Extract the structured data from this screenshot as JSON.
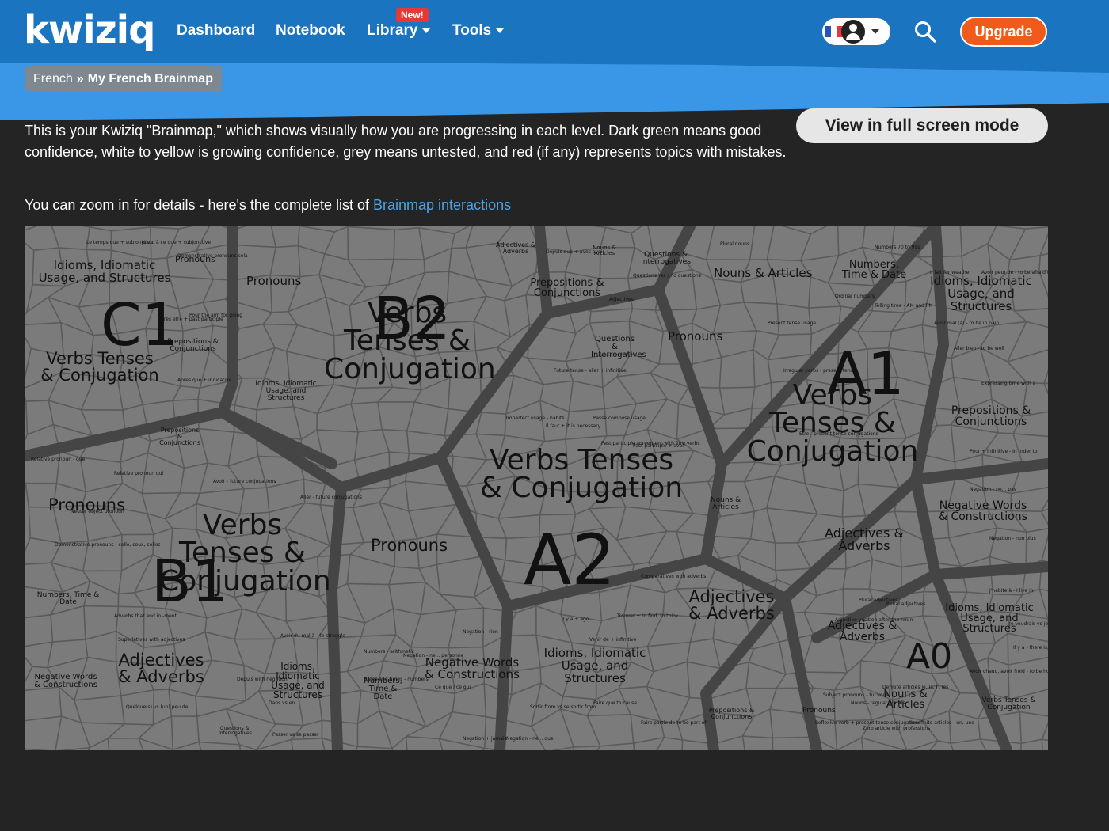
{
  "header": {
    "logo": "kwiziq",
    "nav": [
      {
        "label": "Dashboard"
      },
      {
        "label": "Notebook"
      },
      {
        "label": "Library"
      },
      {
        "label": "Tools"
      }
    ],
    "new_badge": "New!",
    "upgrade": "Upgrade"
  },
  "breadcrumb": {
    "parent": "French",
    "sep": "»",
    "current": "My French Brainmap"
  },
  "fullscreen_label": "View in full screen mode",
  "intro": "This is your Kwiziq \"Brainmap,\" which shows visually how you are progressing in each level. Dark green means good confidence, white to yellow is growing confidence, grey means untested, and red (if any) represents topics with mistakes.",
  "intro2_text": "You can zoom in for details - here's the complete list of ",
  "intro2_link": "Brainmap interactions",
  "brainmap": {
    "levels": {
      "c1": "C1",
      "b2": "B2",
      "a1": "A1",
      "a2": "A2",
      "b1": "B1",
      "a0": "A0"
    },
    "labels": {
      "c1_idioms": "Idioms, Idiomatic Usage, and Structures",
      "c1_pronouns": "Pronouns",
      "c1_verbs": "Verbs Tenses & Conjugation",
      "c1_prep": "Prepositions & Conjunctions",
      "b2_pronouns": "Pronouns",
      "b2_verbs": "Verbs Tenses & Conjugation",
      "b2_prep": "Prepositions & Conjunctions",
      "b2_questions": "Questions & Interrogatives",
      "b2_adj": "Adjectives & Adverbs",
      "b2_nouns": "Nouns & Articles",
      "b2_idioms": "Idioms, Idiomatic Usage, and Structures",
      "a1_nouns": "Nouns & Articles",
      "a1_numbers": "Numbers, Time & Date",
      "a1_idioms": "Idioms, Idiomatic Usage, and Structures",
      "a1_questions": "Questions & Interrogatives",
      "a1_pronouns": "Pronouns",
      "a1_verbs": "Verbs Tenses & Conjugation",
      "a1_prep": "Prepositions & Conjunctions",
      "a1_negative": "Negative Words & Constructions",
      "a1_adj": "Adjectives & Adverbs",
      "b1_pronouns": "Pronouns",
      "b1_verbs": "Verbs Tenses & Conjugation",
      "b1_numbers": "Numbers, Time & Date",
      "b1_adj": "Adjectives & Adverbs",
      "b1_negative": "Negative Words & Constructions",
      "b1_idioms": "Idioms, Idiomatic Usage, and Structures",
      "b1_questions": "Questions & Interrogatives",
      "b1_prep": "Prepositions & Conjunctions",
      "a2_verbs": "Verbs Tenses & Conjugation",
      "a2_pronouns": "Pronouns",
      "a2_nouns": "Nouns & Articles",
      "a2_adj": "Adjectives & Adverbs",
      "a2_numbers": "Numbers, Time & Date",
      "a2_negative": "Negative Words & Constructions",
      "a2_idioms": "Idioms, Idiomatic Usage, and Structures",
      "a2_prep": "Prepositions & Conjunctions",
      "a0_idioms": "Idioms, Idiomatic Usage, and Structures",
      "a0_adj": "Adjectives & Adverbs",
      "a0_pronouns": "Pronouns",
      "a0_nouns": "Nouns & Articles",
      "a0_verbs": "Verbs Tenses & Conjugation"
    },
    "tiny_labels": [
      "Le temps que + subjonctive",
      "Jusqu'à ce que + subjonctive",
      "Demonstrative pronouns cela",
      "Après être + past participle",
      "Pour the aim for going",
      "Après que + indicative",
      "Relative pronoun - que",
      "Relative pronoun qui",
      "Neuter object pronoun",
      "Demonstrative pronouns - celle, ceux, celles",
      "Avoir - future conjugations",
      "Aller - future conjugations",
      "Adjectives",
      "Depuis que + avec avoir",
      "Questions Yes / no questions",
      "Plural nouns",
      "Numbers 70 to 999",
      "Ordinal numbers",
      "Telling time - AM and PM",
      "Il fait for weather",
      "Avoir peur de - to be afraid of",
      "Avoir mal (à) - to be in pain",
      "Aller bien - to be well",
      "Expressing time with à",
      "Pour + infinitive - in order to",
      "Negation - ne... pas",
      "Negation - non plus",
      "J'habite à - I live in",
      "Je voudrais vs je veux",
      "Il y a - there is, are",
      "Avoir chaud, avoir froid - to be hot, cold",
      "Plural adjectives",
      "Adjective position after the noun",
      "Definite articles le, la, l', les",
      "Indefinite articles - un, une",
      "Nouns - regular plurals",
      "Zero article with professions",
      "Subject pronouns - tu, vous",
      "Reflexive verb + present tense conjugations",
      "Present tense usage",
      "Irregular verbs - present tense",
      "Être - present tense conjugations",
      "Imperfect usage - habits",
      "Il faut + it is necessary",
      "Passé composé usage",
      "Past participle agreement with être verbs",
      "Past participle + avoir",
      "Future tense - aller + infinitive",
      "Trouver + to find, to think",
      "Il y a + ago",
      "Venir de + infinitive",
      "Negation + jamais",
      "Negation - ne... que",
      "Negation - ne... personne",
      "Negation - rien",
      "Dates and times - numbers",
      "Numbers - arithmetic",
      "Ce que / ce qui",
      "Sortir from vs se sortir from",
      "Faire que to cause",
      "Faire partie de to be part of",
      "Adverbs that end in -ment",
      "Superlatives with adjectives",
      "Comparatives with adverbs",
      "Quelque(s) vs (un) peu de",
      "Passer vs se passer",
      "Avoir du mal à - to struggle",
      "Depuis with negation",
      "Dans vs en",
      "Plural adjectives"
    ]
  }
}
